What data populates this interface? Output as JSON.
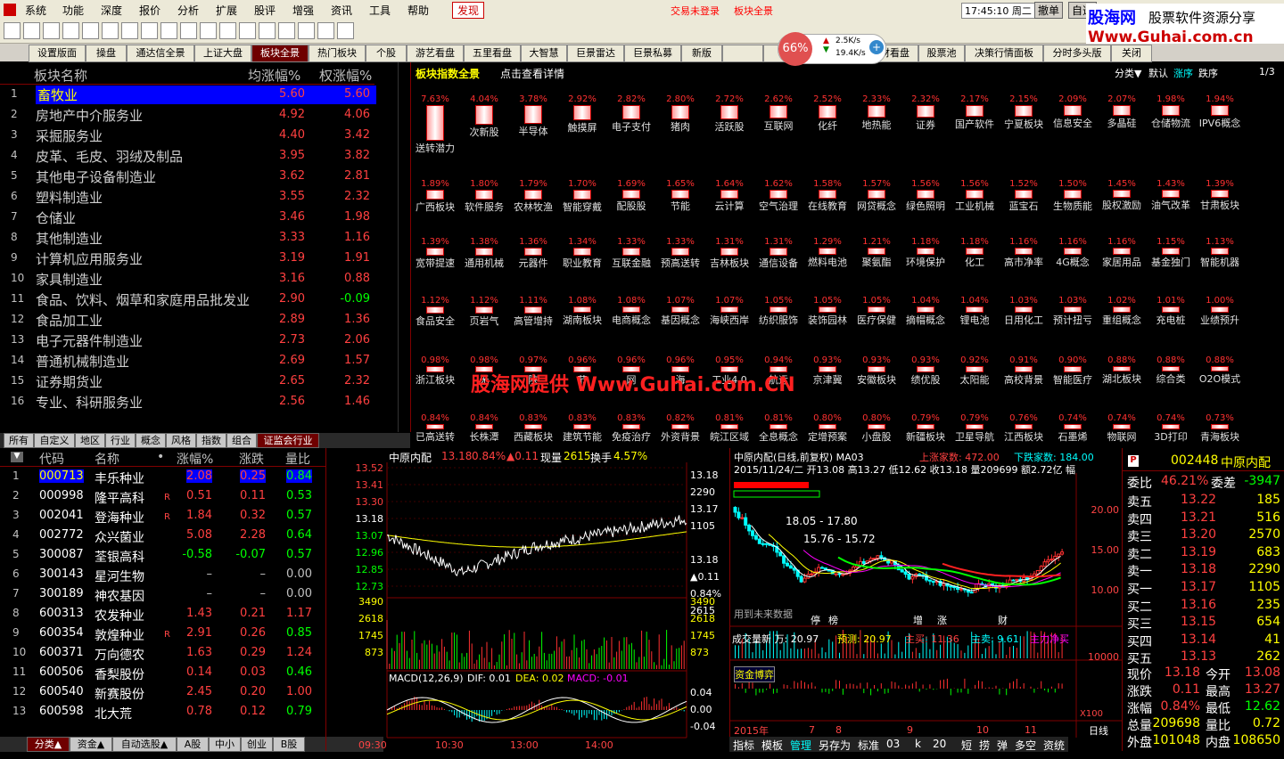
{
  "menu": [
    "系统",
    "功能",
    "深度",
    "报价",
    "分析",
    "扩展",
    "股评",
    "增强",
    "资讯",
    "工具",
    "帮助"
  ],
  "menu_active": "发现",
  "login_status": "交易未登录",
  "login_board": "板块全景",
  "clock": "17:45:10 周二",
  "cancel_btn": "撤单",
  "cancel_btn2": "自选",
  "watermark": {
    "line1": "股海网",
    "line1b": "股票软件资源分享",
    "line2": "Www.Guhai.com.cn"
  },
  "net": {
    "pct": "66%",
    "up": "2.5K/s",
    "down": "19.4K/s"
  },
  "tabs": [
    "设置版面",
    "操盘",
    "通达信全景",
    "上证大盘",
    "板块全景",
    "热门板块",
    "个股",
    "游艺看盘",
    "五里看盘",
    "大智慧",
    "巨景雷达",
    "巨景私募",
    "新版",
    "",
    "",
    "盘中监测",
    "一财看盘",
    "股票池",
    "决策行情面板",
    "分时多头版",
    "关闭"
  ],
  "tabs_active": "板块全景",
  "sector_list": {
    "headers": [
      "板块名称",
      "均涨幅%",
      "权涨幅%"
    ],
    "rows": [
      {
        "n": "1",
        "name": "畜牧业",
        "a": "5.60",
        "b": "5.60"
      },
      {
        "n": "2",
        "name": "房地产中介服务业",
        "a": "4.92",
        "b": "4.06"
      },
      {
        "n": "3",
        "name": "采掘服务业",
        "a": "4.40",
        "b": "3.42"
      },
      {
        "n": "4",
        "name": "皮革、毛皮、羽绒及制品",
        "a": "3.95",
        "b": "3.82"
      },
      {
        "n": "5",
        "name": "其他电子设备制造业",
        "a": "3.62",
        "b": "2.81"
      },
      {
        "n": "6",
        "name": "塑料制造业",
        "a": "3.55",
        "b": "2.32"
      },
      {
        "n": "7",
        "name": "仓储业",
        "a": "3.46",
        "b": "1.98"
      },
      {
        "n": "8",
        "name": "其他制造业",
        "a": "3.33",
        "b": "1.16"
      },
      {
        "n": "9",
        "name": "计算机应用服务业",
        "a": "3.19",
        "b": "1.91"
      },
      {
        "n": "10",
        "name": "家具制造业",
        "a": "3.16",
        "b": "0.88"
      },
      {
        "n": "11",
        "name": "食品、饮料、烟草和家庭用品批发业",
        "a": "2.90",
        "b": "-0.09"
      },
      {
        "n": "12",
        "name": "食品加工业",
        "a": "2.89",
        "b": "1.36"
      },
      {
        "n": "13",
        "name": "电子元器件制造业",
        "a": "2.73",
        "b": "2.06"
      },
      {
        "n": "14",
        "name": "普通机械制造业",
        "a": "2.69",
        "b": "1.57"
      },
      {
        "n": "15",
        "name": "证券期货业",
        "a": "2.65",
        "b": "2.32"
      },
      {
        "n": "16",
        "name": "专业、科研服务业",
        "a": "2.56",
        "b": "1.46"
      }
    ]
  },
  "board": {
    "title": "板块指数全景",
    "hint": "点击查看详情",
    "sort_labels": [
      "分类▼",
      "默认",
      "涨序",
      "跌序"
    ],
    "page": "1/3",
    "watermark": "股海网提供 Www.Guhai.com.CN",
    "rows": [
      [
        [
          "7.63%",
          "送转潜力"
        ],
        [
          "4.04%",
          "次新股"
        ],
        [
          "3.78%",
          "半导体"
        ],
        [
          "2.92%",
          "触摸屏"
        ],
        [
          "2.82%",
          "电子支付"
        ],
        [
          "2.80%",
          "猪肉"
        ],
        [
          "2.72%",
          "活跃股"
        ],
        [
          "2.62%",
          "互联网"
        ],
        [
          "2.52%",
          "化纤"
        ],
        [
          "2.33%",
          "地热能"
        ],
        [
          "2.32%",
          "证券"
        ],
        [
          "2.17%",
          "国产软件"
        ],
        [
          "2.15%",
          "宁夏板块"
        ],
        [
          "2.09%",
          "信息安全"
        ],
        [
          "2.07%",
          "多晶硅"
        ],
        [
          "1.98%",
          "仓储物流"
        ],
        [
          "1.94%",
          "IPV6概念"
        ]
      ],
      [
        [
          "1.89%",
          "广西板块"
        ],
        [
          "1.80%",
          "软件服务"
        ],
        [
          "1.79%",
          "农林牧渔"
        ],
        [
          "1.70%",
          "智能穿戴"
        ],
        [
          "1.69%",
          "配股股"
        ],
        [
          "1.65%",
          "节能"
        ],
        [
          "1.64%",
          "云计算"
        ],
        [
          "1.62%",
          "空气治理"
        ],
        [
          "1.58%",
          "在线教育"
        ],
        [
          "1.57%",
          "网贷概念"
        ],
        [
          "1.56%",
          "绿色照明"
        ],
        [
          "1.56%",
          "工业机械"
        ],
        [
          "1.52%",
          "蓝宝石"
        ],
        [
          "1.50%",
          "生物质能"
        ],
        [
          "1.45%",
          "股权激励"
        ],
        [
          "1.43%",
          "油气改革"
        ],
        [
          "1.39%",
          "甘肃板块"
        ]
      ],
      [
        [
          "1.39%",
          "宽带提速"
        ],
        [
          "1.38%",
          "通用机械"
        ],
        [
          "1.36%",
          "元器件"
        ],
        [
          "1.34%",
          "职业教育"
        ],
        [
          "1.33%",
          "互联金融"
        ],
        [
          "1.33%",
          "预高送转"
        ],
        [
          "1.31%",
          "吉林板块"
        ],
        [
          "1.31%",
          "通信设备"
        ],
        [
          "1.29%",
          "燃料电池"
        ],
        [
          "1.21%",
          "聚氨酯"
        ],
        [
          "1.18%",
          "环境保护"
        ],
        [
          "1.18%",
          "化工"
        ],
        [
          "1.16%",
          "高市净率"
        ],
        [
          "1.16%",
          "4G概念"
        ],
        [
          "1.16%",
          "家居用品"
        ],
        [
          "1.15%",
          "基金独门"
        ],
        [
          "1.13%",
          "智能机器"
        ]
      ],
      [
        [
          "1.12%",
          "食品安全"
        ],
        [
          "1.12%",
          "页岩气"
        ],
        [
          "1.11%",
          "高管增持"
        ],
        [
          "1.08%",
          "湖南板块"
        ],
        [
          "1.08%",
          "电商概念"
        ],
        [
          "1.07%",
          "基因概念"
        ],
        [
          "1.07%",
          "海峡西岸"
        ],
        [
          "1.05%",
          "纺织服饰"
        ],
        [
          "1.05%",
          "装饰园林"
        ],
        [
          "1.05%",
          "医疗保健"
        ],
        [
          "1.04%",
          "摘帽概念"
        ],
        [
          "1.04%",
          "锂电池"
        ],
        [
          "1.03%",
          "日用化工"
        ],
        [
          "1.03%",
          "预计扭亏"
        ],
        [
          "1.02%",
          "重组概念"
        ],
        [
          "1.01%",
          "充电桩"
        ],
        [
          "1.00%",
          "业绩预升"
        ]
      ],
      [
        [
          "0.98%",
          "浙江板块"
        ],
        [
          "0.98%",
          "无"
        ],
        [
          "0.97%",
          "陕"
        ],
        [
          "0.96%",
          "节"
        ],
        [
          "0.96%",
          "网"
        ],
        [
          "0.96%",
          "海"
        ],
        [
          "0.95%",
          "工业4.0"
        ],
        [
          "0.94%",
          "航运"
        ],
        [
          "0.93%",
          "京津冀"
        ],
        [
          "0.93%",
          "安徽板块"
        ],
        [
          "0.93%",
          "绩优股"
        ],
        [
          "0.92%",
          "太阳能"
        ],
        [
          "0.91%",
          "高校背景"
        ],
        [
          "0.90%",
          "智能医疗"
        ],
        [
          "0.88%",
          "湖北板块"
        ],
        [
          "0.88%",
          "综合类"
        ],
        [
          "0.88%",
          "O2O模式"
        ]
      ],
      [
        [
          "0.84%",
          "已高送转"
        ],
        [
          "0.84%",
          "长株潭"
        ],
        [
          "0.83%",
          "西藏板块"
        ],
        [
          "0.83%",
          "建筑节能"
        ],
        [
          "0.83%",
          "免疫治疗"
        ],
        [
          "0.82%",
          "外资背景"
        ],
        [
          "0.81%",
          "皖江区域"
        ],
        [
          "0.81%",
          "全息概念"
        ],
        [
          "0.80%",
          "定增预案"
        ],
        [
          "0.80%",
          "小盘股"
        ],
        [
          "0.79%",
          "新疆板块"
        ],
        [
          "0.79%",
          "卫星导航"
        ],
        [
          "0.76%",
          "江西板块"
        ],
        [
          "0.74%",
          "石墨烯"
        ],
        [
          "0.74%",
          "物联网"
        ],
        [
          "0.74%",
          "3D打印"
        ],
        [
          "0.73%",
          "青海板块"
        ]
      ]
    ]
  },
  "left_tabs": [
    "所有",
    "自定义",
    "地区",
    "行业",
    "概念",
    "风格",
    "指数",
    "组合",
    "证监会行业"
  ],
  "left_tabs_active": "证监会行业",
  "stock_list": {
    "headers": [
      "代码",
      "名称",
      "•",
      "涨幅%",
      "涨跌",
      "量比"
    ],
    "rows": [
      {
        "n": "1",
        "code": "000713",
        "name": "丰乐种业",
        "r": "",
        "pct": "2.08",
        "chg": "0.25",
        "vr": "0.84"
      },
      {
        "n": "2",
        "code": "000998",
        "name": "隆平高科",
        "r": "R",
        "pct": "0.51",
        "chg": "0.11",
        "vr": "0.53"
      },
      {
        "n": "3",
        "code": "002041",
        "name": "登海种业",
        "r": "R",
        "pct": "1.84",
        "chg": "0.32",
        "vr": "0.57"
      },
      {
        "n": "4",
        "code": "002772",
        "name": "众兴菌业",
        "r": "",
        "pct": "5.08",
        "chg": "2.28",
        "vr": "0.64"
      },
      {
        "n": "5",
        "code": "300087",
        "name": "荃银高科",
        "r": "",
        "pct": "-0.58",
        "chg": "-0.07",
        "vr": "0.57"
      },
      {
        "n": "6",
        "code": "300143",
        "name": "星河生物",
        "r": "",
        "pct": "–",
        "chg": "–",
        "vr": "0.00"
      },
      {
        "n": "7",
        "code": "300189",
        "name": "神农基因",
        "r": "",
        "pct": "–",
        "chg": "–",
        "vr": "0.00"
      },
      {
        "n": "8",
        "code": "600313",
        "name": "农发种业",
        "r": "",
        "pct": "1.43",
        "chg": "0.21",
        "vr": "1.17"
      },
      {
        "n": "9",
        "code": "600354",
        "name": "敦煌种业",
        "r": "R",
        "pct": "2.91",
        "chg": "0.26",
        "vr": "0.85"
      },
      {
        "n": "10",
        "code": "600371",
        "name": "万向德农",
        "r": "",
        "pct": "1.63",
        "chg": "0.29",
        "vr": "1.24"
      },
      {
        "n": "11",
        "code": "600506",
        "name": "香梨股份",
        "r": "",
        "pct": "0.14",
        "chg": "0.03",
        "vr": "0.46"
      },
      {
        "n": "12",
        "code": "600540",
        "name": "新赛股份",
        "r": "",
        "pct": "2.45",
        "chg": "0.20",
        "vr": "1.00"
      },
      {
        "n": "13",
        "code": "600598",
        "name": "北大荒",
        "r": "",
        "pct": "0.78",
        "chg": "0.12",
        "vr": "0.79"
      }
    ]
  },
  "bottom_tabs": [
    "分类▲",
    "资金▲",
    "自动选股▲",
    "A股",
    "中小",
    "创业",
    "B股"
  ],
  "intraday": {
    "title": "中原内配",
    "price": "13.18",
    "pct": "0.84%",
    "chg": "▲0.11",
    "vol_label": "现量",
    "vol": "2615",
    "turn_label": "换手",
    "turn": "4.57%",
    "y_left": [
      "13.52",
      "13.41",
      "13.30",
      "13.18",
      "13.07",
      "12.96",
      "12.85",
      "12.73"
    ],
    "y_right": [
      "13.18",
      "2290",
      "13.17",
      "1105",
      "",
      "13.18",
      "▲0.11",
      "0.84%",
      "2615"
    ],
    "vol_left": [
      "3490",
      "2618",
      "1745",
      "873"
    ],
    "vol_right": [
      "3490",
      "2618",
      "1745",
      "873"
    ],
    "macd_label": "MACD(12,26,9)",
    "dif": "DIF: 0.01",
    "dea": "DEA: 0.02",
    "macd": "MACD: -0.01",
    "macd_y": [
      "0.04",
      "0.00",
      "-0.04"
    ],
    "times": [
      "09:30",
      "10:30",
      "13:00",
      "14:00"
    ]
  },
  "kline": {
    "title": "中原内配(日线,前复权) MA03",
    "up_label": "上涨家数: 472.00",
    "down_label": "下跌家数: 184.00",
    "info": "2015/11/24/二 开13.08 高13.27 低12.62 收13.18 量209699 额2.72亿 幅",
    "range1": "18.05 - 17.80",
    "range2": "15.76 - 15.72",
    "future": "用到未来数据",
    "y": [
      "20.00",
      "15.00",
      "10.00"
    ],
    "markers": [
      "停",
      "榜",
      "增",
      "涨",
      "财"
    ],
    "vol_bar": "成交量新 万: 20.97",
    "forecast": "预测: 20.97",
    "main_label1": "主买: 11.36",
    "main_label2": "主卖: 9.61",
    "main_label3": "主力净买",
    "vol_y": "10000",
    "fund_label": "资金博弈",
    "year": "2015年",
    "x_ticks": [
      "7",
      "8",
      "9",
      "10",
      "11"
    ],
    "x100": "X100",
    "period": "日线"
  },
  "kline_tabs": [
    "指标",
    "模板",
    "管理",
    "另存为",
    "标准",
    "03",
    "k",
    "20",
    "短",
    "捞",
    "弹",
    "多空",
    "资统"
  ],
  "quote": {
    "code": "002448",
    "name": "中原内配",
    "wb_label": "委比",
    "wb": "46.21%",
    "wc_label": "委差",
    "wc": "-3947",
    "sells": [
      [
        "卖五",
        "13.22",
        "185"
      ],
      [
        "卖四",
        "13.21",
        "516"
      ],
      [
        "卖三",
        "13.20",
        "2570"
      ],
      [
        "卖二",
        "13.19",
        "683"
      ],
      [
        "卖一",
        "13.18",
        "2290"
      ]
    ],
    "buys": [
      [
        "买一",
        "13.17",
        "1105"
      ],
      [
        "买二",
        "13.16",
        "235"
      ],
      [
        "买三",
        "13.15",
        "654"
      ],
      [
        "买四",
        "13.14",
        "41"
      ],
      [
        "买五",
        "13.13",
        "262"
      ]
    ],
    "stats": [
      [
        "现价",
        "13.18",
        "今开",
        "13.08"
      ],
      [
        "涨跌",
        "0.11",
        "最高",
        "13.27"
      ],
      [
        "涨幅",
        "0.84%",
        "最低",
        "12.62"
      ],
      [
        "总量",
        "209698",
        "量比",
        "0.72"
      ],
      [
        "外盘",
        "101048",
        "内盘",
        "108650"
      ]
    ]
  },
  "colors": {
    "up": "#ff4040",
    "down": "#00ff00",
    "frame": "#800000",
    "accent": "#ffff00"
  }
}
